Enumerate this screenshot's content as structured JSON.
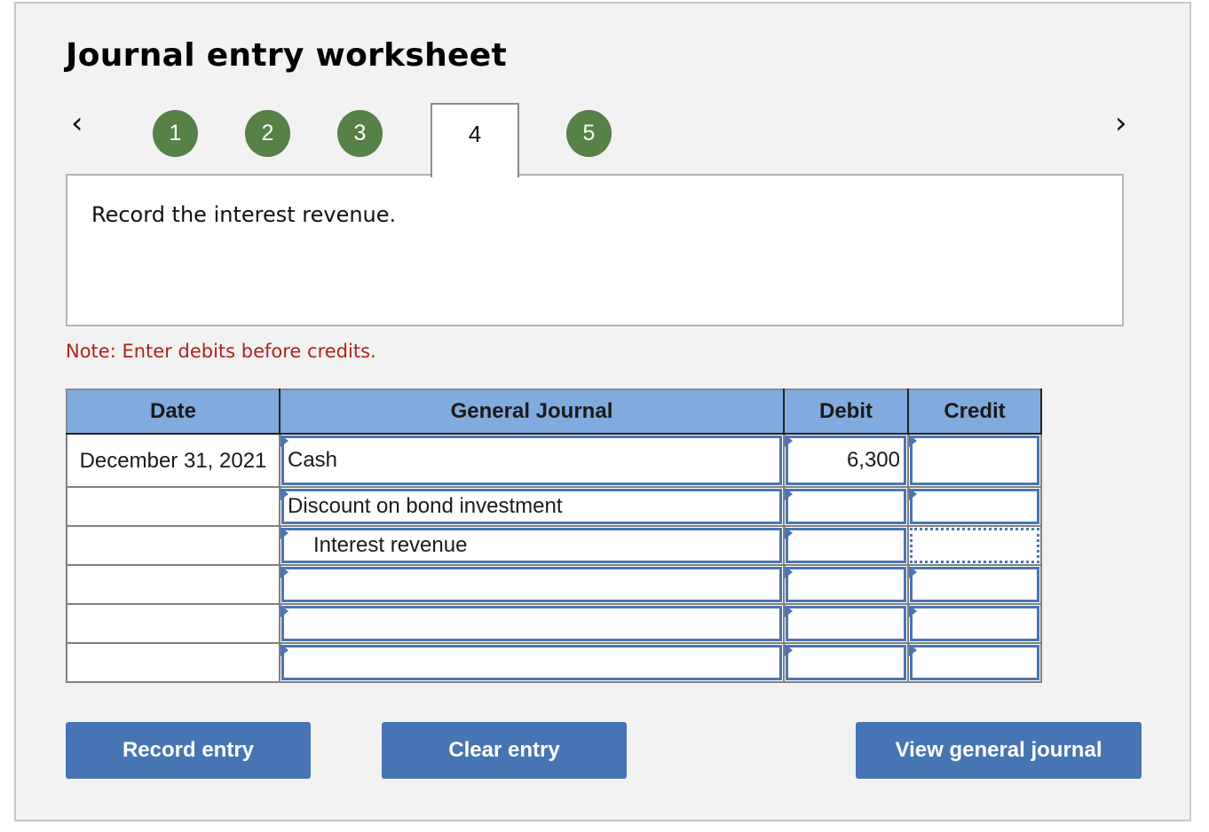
{
  "header": {
    "title": "Journal entry worksheet"
  },
  "stepper": {
    "prev_icon": "chevron-left-icon",
    "next_icon": "chevron-right-icon",
    "prev_glyph": "‹",
    "next_glyph": "›",
    "steps": [
      {
        "label": "1",
        "state": "completed"
      },
      {
        "label": "2",
        "state": "completed"
      },
      {
        "label": "3",
        "state": "completed"
      },
      {
        "label": "4",
        "state": "active"
      },
      {
        "label": "5",
        "state": "completed"
      }
    ],
    "completed_color": "#568147"
  },
  "instruction": {
    "text": "Record the interest revenue."
  },
  "note": {
    "text": "Note: Enter debits before credits.",
    "color": "#b0221c"
  },
  "journal": {
    "columns": [
      "Date",
      "General Journal",
      "Debit",
      "Credit"
    ],
    "header_color": "#81aade",
    "rows": [
      {
        "date": "December 31, 2021",
        "account": "Cash",
        "debit": "6,300",
        "credit": ""
      },
      {
        "date": "",
        "account": "Discount on bond investment",
        "debit": "",
        "credit": ""
      },
      {
        "date": "",
        "account": "Interest revenue",
        "debit": "",
        "credit": ""
      },
      {
        "date": "",
        "account": "",
        "debit": "",
        "credit": ""
      },
      {
        "date": "",
        "account": "",
        "debit": "",
        "credit": ""
      },
      {
        "date": "",
        "account": "",
        "debit": "",
        "credit": ""
      }
    ]
  },
  "buttons": {
    "record": "Record entry",
    "clear": "Clear entry",
    "view": "View general journal",
    "color": "#4775b3"
  }
}
